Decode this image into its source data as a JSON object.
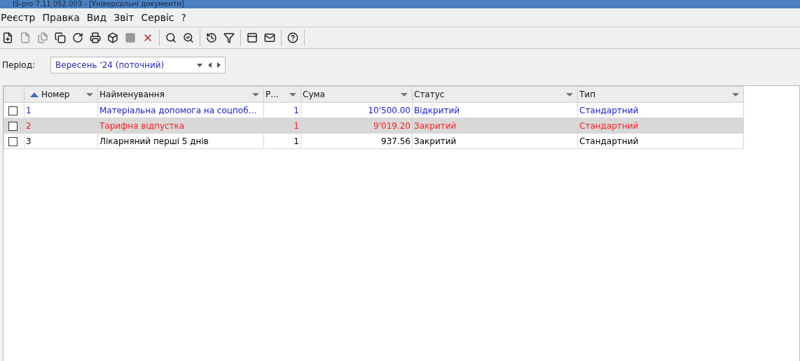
{
  "window": {
    "title": "IS-pro 7.11.052.003 - [Універсальні документи]"
  },
  "menu": [
    "Реєстр",
    "Правка",
    "Вид",
    "Звіт",
    "Сервіс",
    "?"
  ],
  "period": {
    "label": "Період:",
    "value": "Вересень '24 (поточний)"
  },
  "table": {
    "columns": [
      {
        "label": "Номер",
        "sorted": true
      },
      {
        "label": "Найменування",
        "sorted": false
      },
      {
        "label": "Р...",
        "sorted": false
      },
      {
        "label": "Сума",
        "sorted": false
      },
      {
        "label": "Статус",
        "sorted": false
      },
      {
        "label": "Тип",
        "sorted": false
      }
    ],
    "rows": [
      {
        "checked": false,
        "selected": false,
        "color": "#1a1ad0",
        "cells": [
          "1",
          "Матеріальна допомога на соцпоб…",
          "1",
          "10'500.00",
          "Відкритий",
          "Стандартний"
        ]
      },
      {
        "checked": false,
        "selected": true,
        "color": "#ff2020",
        "cells": [
          "2",
          "Тарифна відпустка",
          "1",
          "9'019.20",
          "Закритий",
          "Стандартний"
        ]
      },
      {
        "checked": false,
        "selected": false,
        "color": "#000000",
        "cells": [
          "3",
          "Лікарняний перші 5 днів",
          "1",
          "937.56",
          "Закритий",
          "Стандартний"
        ]
      }
    ]
  }
}
